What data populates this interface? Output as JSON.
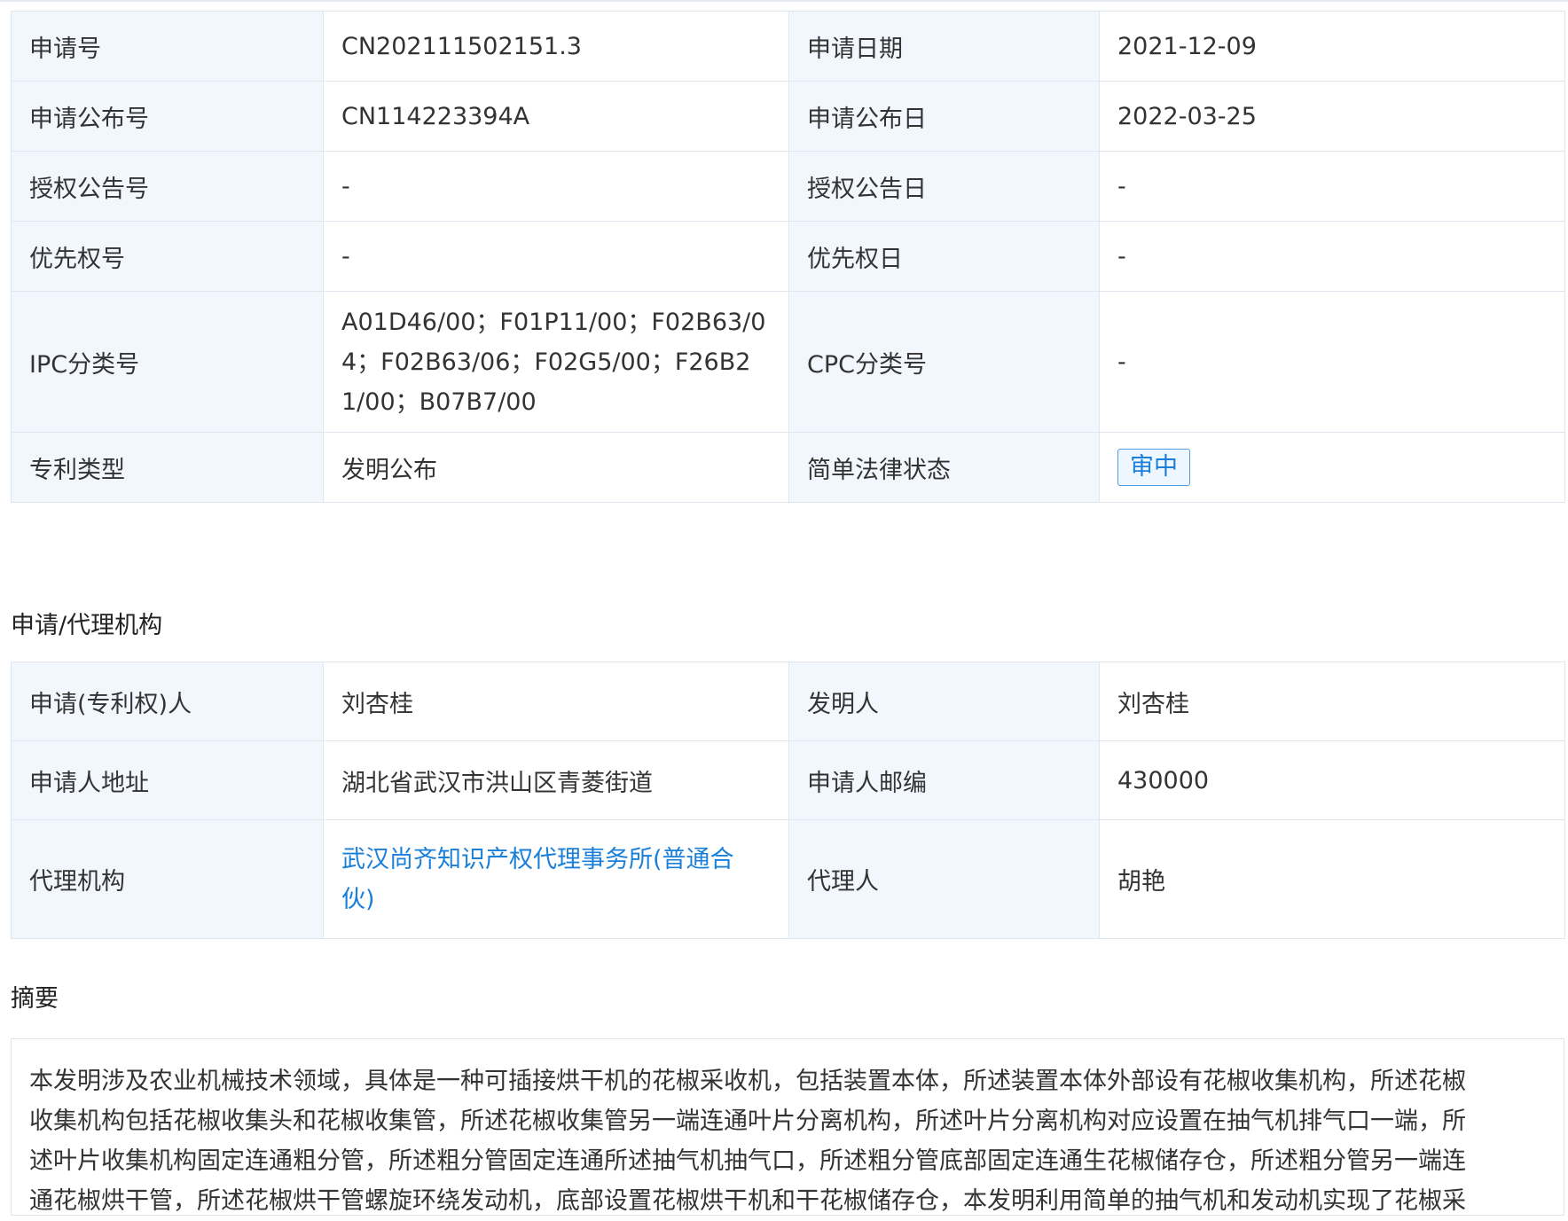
{
  "basic_info": {
    "rows": [
      {
        "l1": "申请号",
        "v1": "CN202111502151.3",
        "l2": "申请日期",
        "v2": "2021-12-09"
      },
      {
        "l1": "申请公布号",
        "v1": "CN114223394A",
        "l2": "申请公布日",
        "v2": "2022-03-25"
      },
      {
        "l1": "授权公告号",
        "v1": "-",
        "l2": "授权公告日",
        "v2": "-"
      },
      {
        "l1": "优先权号",
        "v1": "-",
        "l2": "优先权日",
        "v2": "-"
      },
      {
        "l1": "IPC分类号",
        "v1_lines": [
          "A01D46/00；F01P11/00；F02B63/0",
          "4；F02B63/06；F02G5/00；F26B2",
          "1/00；B07B7/00"
        ],
        "l2": "CPC分类号",
        "v2": "-"
      },
      {
        "l1": "专利类型",
        "v1": "发明公布",
        "l2": "简单法律状态",
        "v2_badge": "审中"
      }
    ]
  },
  "agency": {
    "section_title": "申请/代理机构",
    "rows": [
      {
        "l1": "申请(专利权)人",
        "v1": "刘杏桂",
        "l2": "发明人",
        "v2": "刘杏桂"
      },
      {
        "l1": "申请人地址",
        "v1": "湖北省武汉市洪山区青菱街道",
        "l2": "申请人邮编",
        "v2": "430000"
      },
      {
        "l1": "代理机构",
        "v1_link_lines": [
          "武汉尚齐知识产权代理事务所(普通合",
          "伙)"
        ],
        "l2": "代理人",
        "v2": "胡艳"
      }
    ]
  },
  "abstract": {
    "section_title": "摘要",
    "lines": [
      "本发明涉及农业机械技术领域，具体是一种可插接烘干机的花椒采收机，包括装置本体，所述装置本体外部设有花椒收集机构，所述花椒",
      "收集机构包括花椒收集头和花椒收集管，所述花椒收集管另一端连通叶片分离机构，所述叶片分离机构对应设置在抽气机排气口一端，所",
      "述叶片收集机构固定连通粗分管，所述粗分管固定连通所述抽气机抽气口，所述粗分管底部固定连通生花椒储存仓，所述粗分管另一端连",
      "通花椒烘干管，所述花椒烘干管螺旋环绕发动机，底部设置花椒烘干机和干花椒储存仓，本发明利用简单的抽气机和发动机实现了花椒采"
    ]
  },
  "colors": {
    "label_bg": "#f2f7fd",
    "border": "#dfe6ef",
    "link": "#1a7fd9"
  }
}
